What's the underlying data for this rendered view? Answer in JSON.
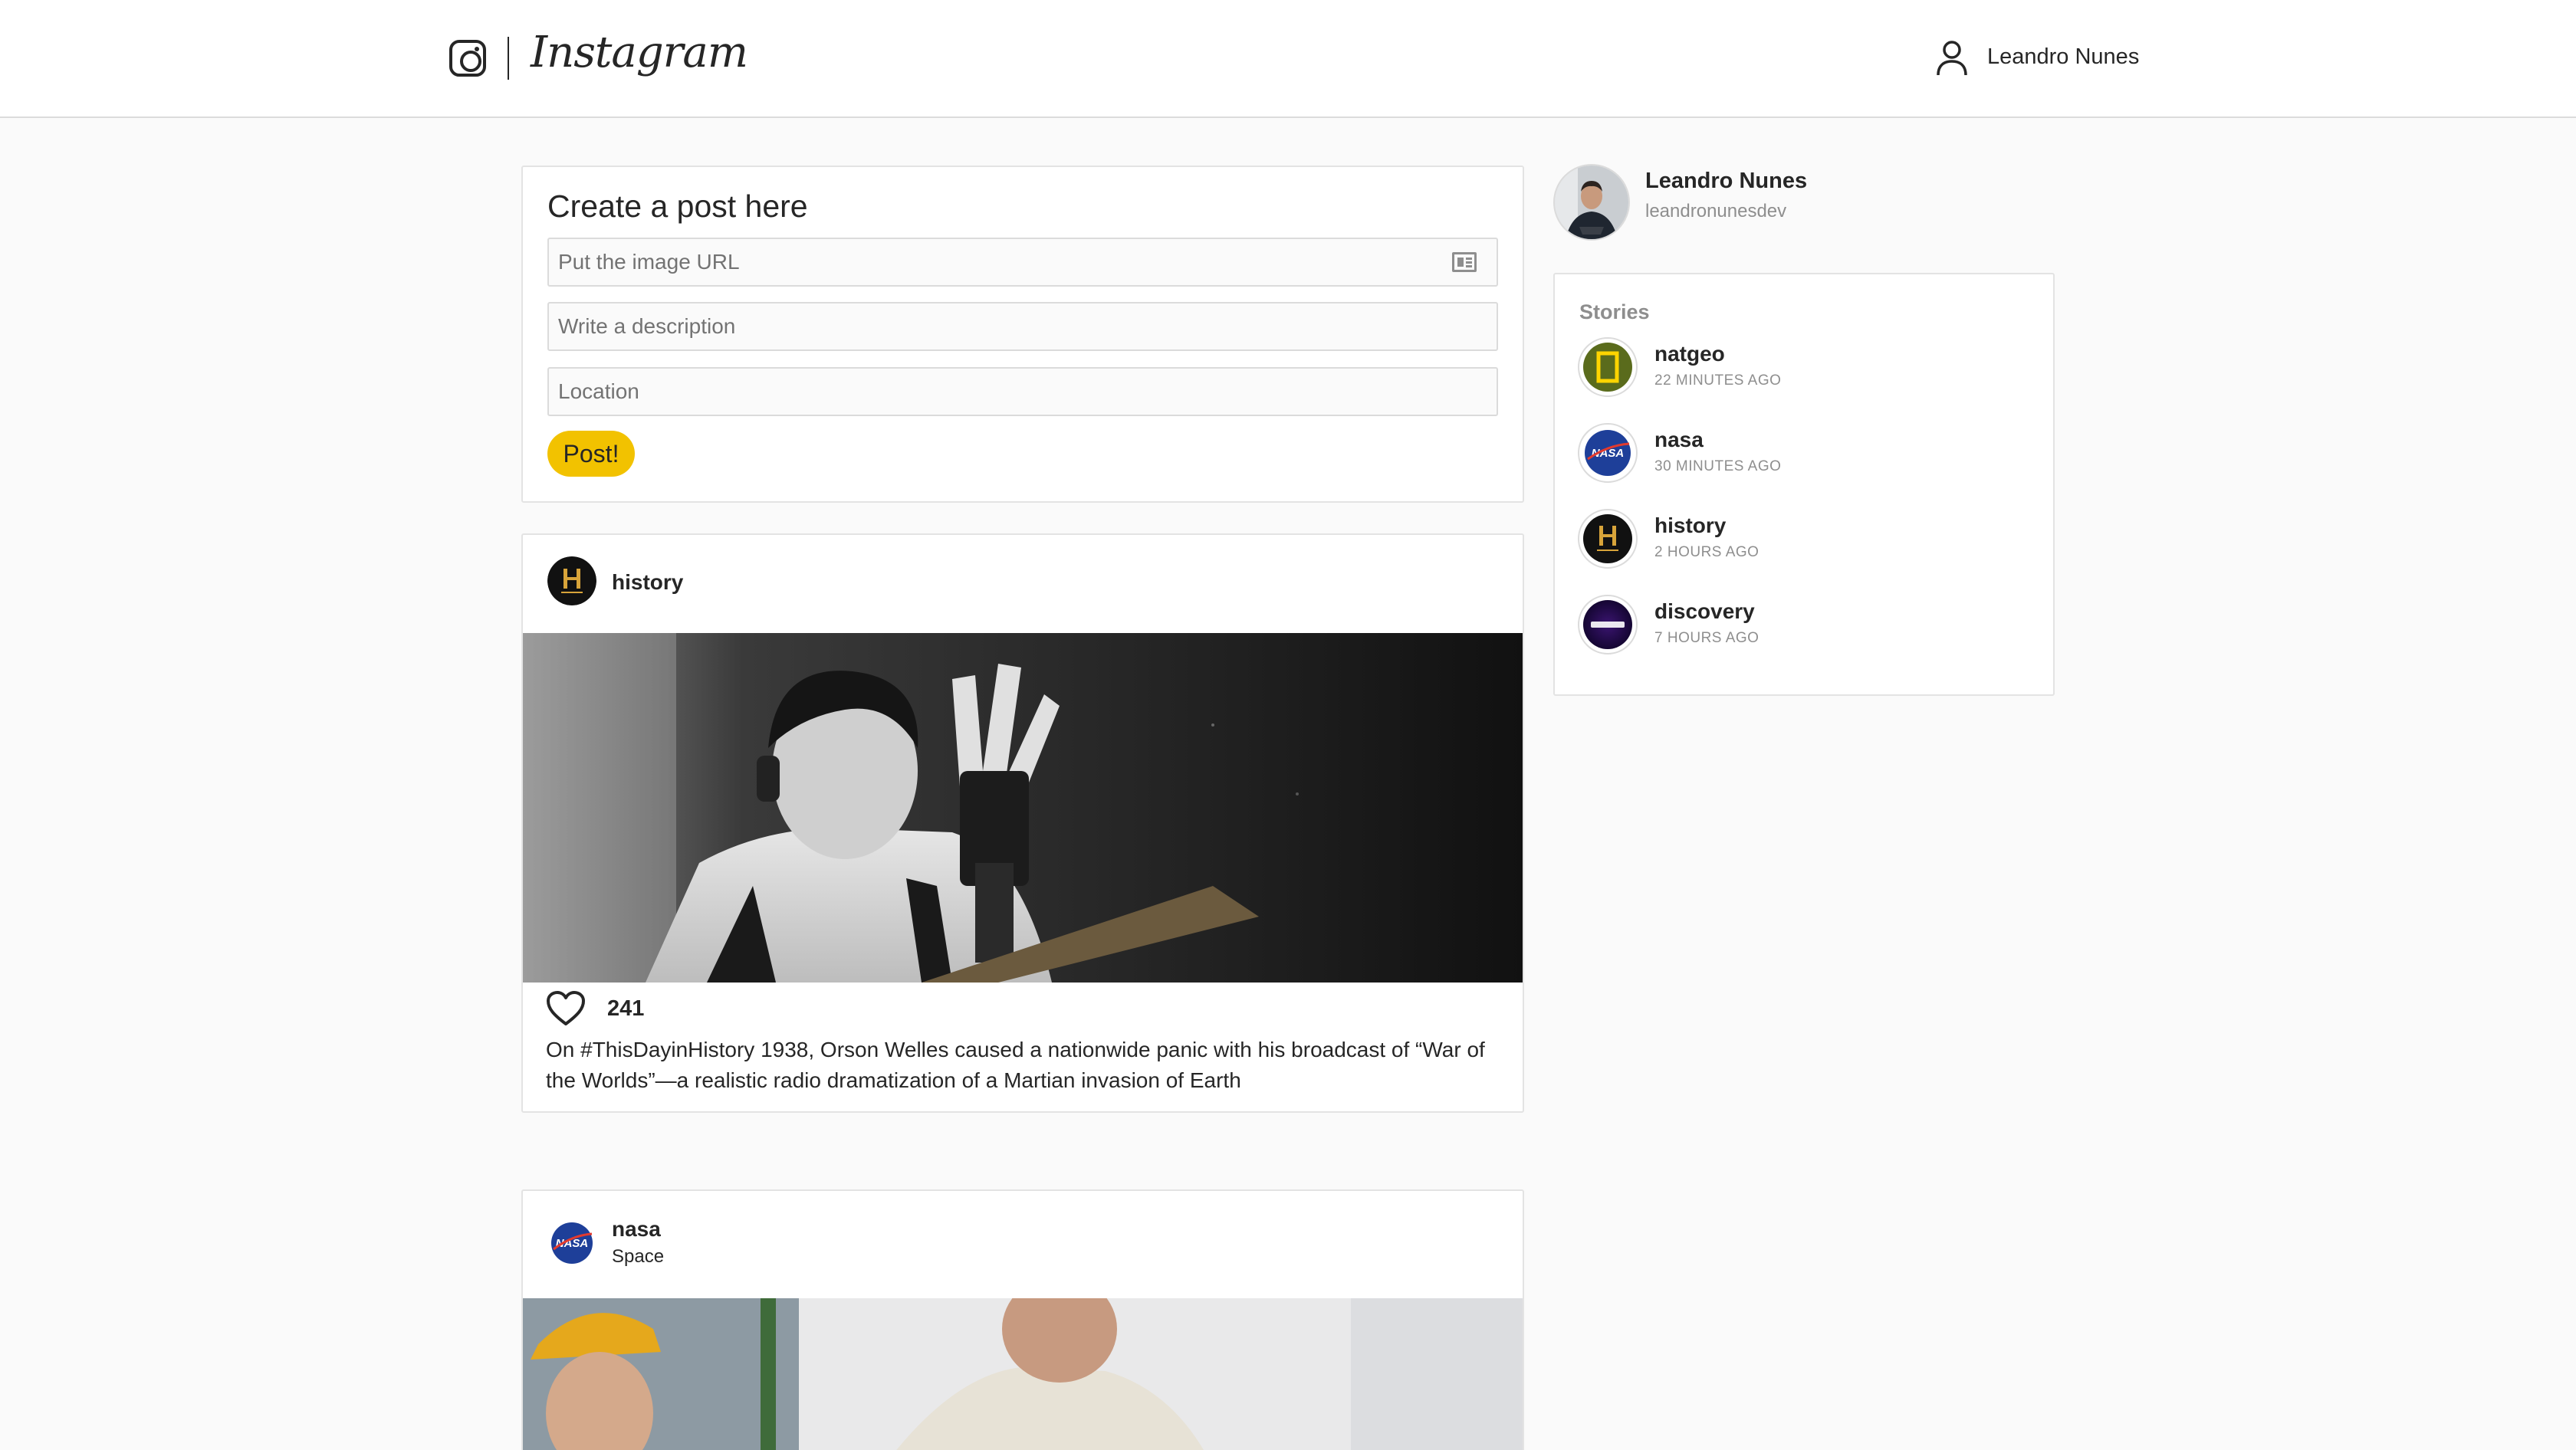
{
  "header": {
    "logo_icon": "instagram-glyph-icon",
    "wordmark": "Instagram",
    "user_icon": "user-icon",
    "username": "Leandro Nunes"
  },
  "create_post": {
    "title": "Create a post here",
    "image_url_placeholder": "Put the image URL",
    "image_url_icon": "image-card-icon",
    "description_placeholder": "Write a description",
    "location_placeholder": "Location",
    "submit_label": "Post!",
    "accent_color": "#f2c200"
  },
  "feed": [
    {
      "user": "history",
      "location": "",
      "likes": "241",
      "like_icon": "heart-icon",
      "caption": "On #ThisDayinHistory 1938, Orson Welles caused a nationwide panic with his broadcast of “War of the Worlds”—a realistic radio dramatization of a Martian invasion of Earth"
    },
    {
      "user": "nasa",
      "location": "Space"
    }
  ],
  "profile": {
    "name": "Leandro Nunes",
    "handle": "leandronunesdev"
  },
  "stories": {
    "title": "Stories",
    "items": [
      {
        "name": "natgeo",
        "time": "22 MINUTES AGO"
      },
      {
        "name": "nasa",
        "time": "30 MINUTES AGO"
      },
      {
        "name": "history",
        "time": "2 HOURS AGO"
      },
      {
        "name": "discovery",
        "time": "7 HOURS AGO"
      }
    ]
  }
}
